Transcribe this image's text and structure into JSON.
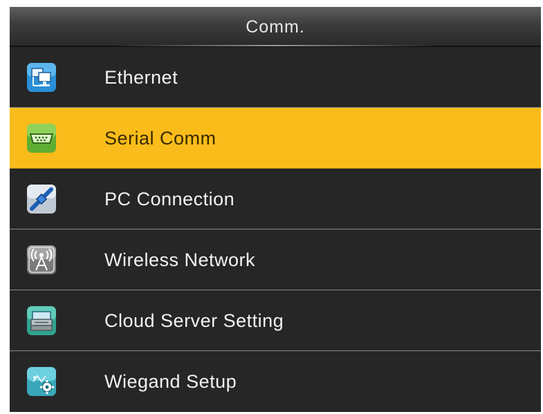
{
  "header": {
    "title": "Comm."
  },
  "menu": {
    "selected_index": 1,
    "items": [
      {
        "label": "Ethernet",
        "icon": "ethernet-icon"
      },
      {
        "label": "Serial Comm",
        "icon": "serial-port-icon"
      },
      {
        "label": "PC Connection",
        "icon": "pc-connection-icon"
      },
      {
        "label": "Wireless Network",
        "icon": "wireless-antenna-icon"
      },
      {
        "label": "Cloud Server Setting",
        "icon": "cloud-server-icon"
      },
      {
        "label": "Wiegand Setup",
        "icon": "wiegand-settings-icon"
      }
    ]
  },
  "colors": {
    "background": "#262626",
    "selected_row": "#f9bc1a",
    "text": "#f2f2f2",
    "divider": "#8a8a8a"
  }
}
